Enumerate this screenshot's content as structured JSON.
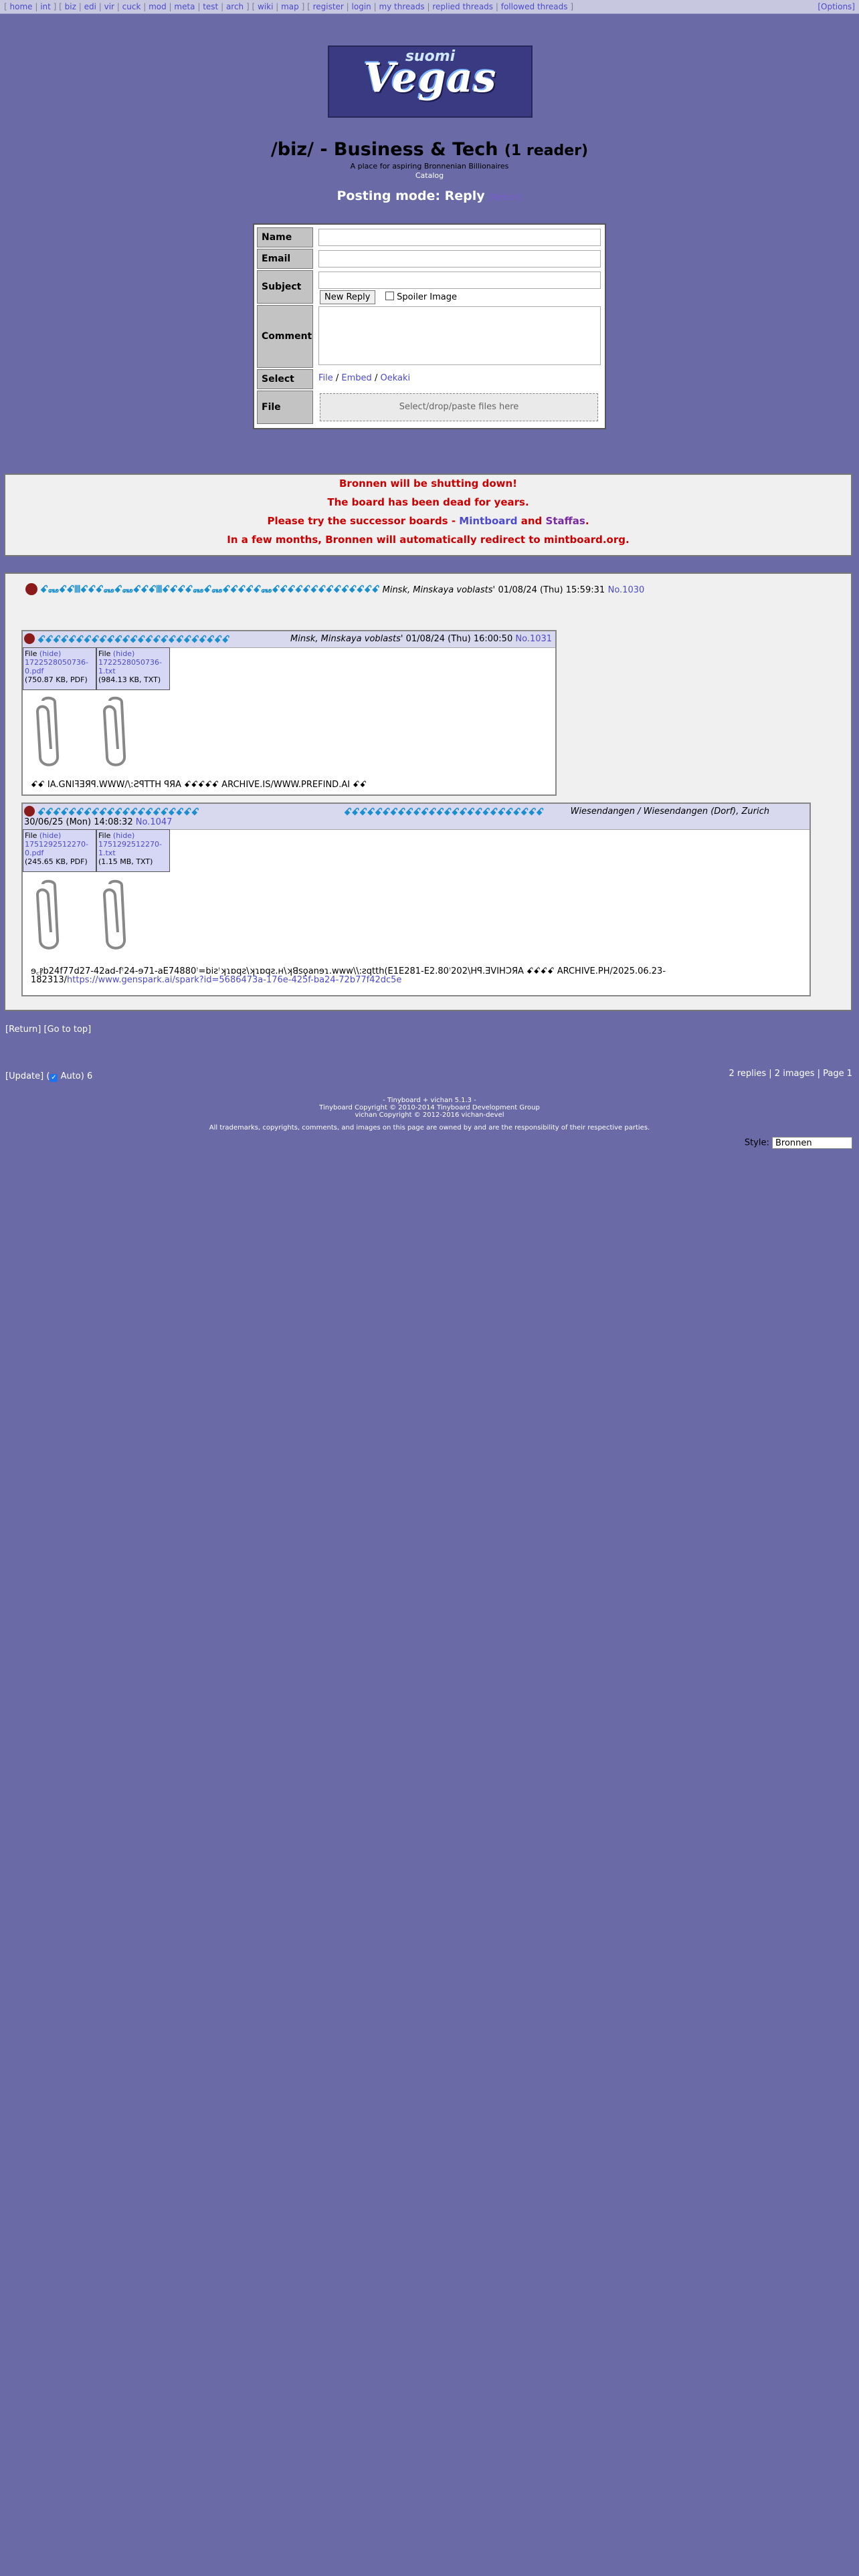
{
  "topnav": {
    "links": [
      "home",
      "int",
      "biz",
      "edi",
      "vir",
      "cuck",
      "mod",
      "meta",
      "test",
      "arch",
      "wiki",
      "map",
      "register",
      "login",
      "my threads",
      "replied threads",
      "followed threads"
    ],
    "options": "[Options]"
  },
  "banner": {
    "logo_top": "suomi",
    "logo_main": "Vegas"
  },
  "board": {
    "title": "/biz/ - Business & Tech",
    "readers": "(1 reader)",
    "subtitle": "A place for aspiring Bronnenian Billionaires",
    "catalog": "Catalog",
    "posting_mode": "Posting mode: Reply",
    "return_link": "[Return]"
  },
  "form": {
    "name_label": "Name",
    "email_label": "Email",
    "subject_label": "Subject",
    "comment_label": "Comment",
    "select_label": "Select",
    "file_label": "File",
    "new_reply": "New Reply",
    "spoiler": "Spoiler Image",
    "select_opts": [
      "File",
      "Embed",
      "Oekaki"
    ],
    "dropzone": "Select/drop/paste files here"
  },
  "notice": {
    "line1": "Bronnen will be shutting down!",
    "line2": "The board has been dead for years.",
    "line3_pre": "Please try the successor boards -",
    "mintboard": "Mintboard",
    "and": "and",
    "staffas": "Staffas",
    "line4": "In a few months, Bronnen will automatically redirect to mintboard.org."
  },
  "op": {
    "subject": "ꗃ꘏ꗃꗃꘈꗃꗃꗃ꘏ꗃ꘏ꗃꗃꗃꘈꗃꗃꗃꗃ꘏ꗃ꘏ꗃꗃꗃꗃꗃ꘏ꗃꗃꗃꗃꗃꗃꗃꗃꗃꗃꗃꗃꗃꗃ",
    "name": "Minsk, Minskaya voblasts'",
    "date": "01/08/24 (Thu) 15:59:31",
    "no": "No.1030"
  },
  "replies": [
    {
      "subject": "ꗃꗃꗃꗃꗃꗃꗃꗃꗃꗃꗃꗃꗃꗃꗃꗃꗃꗃꗃꗃꗃꗃꗃꗃꗃ",
      "name": "Minsk, Minskaya voblasts'",
      "date": "01/08/24 (Thu) 16:00:50",
      "no": "No.1031",
      "files": [
        {
          "head": "File",
          "hide": "(hide)",
          "name": "1722528050736-0.pdf",
          "size": "(750.87 KB,",
          "extra": "PDF)"
        },
        {
          "head": "File",
          "hide": "(hide)",
          "name": "1722528050736-1.txt",
          "size": "(984.13 KB,",
          "extra": "TXT)"
        }
      ],
      "body": "ꗃꗃ IA.GNIꟻƎЯꟼ.WWW/\\:ƧꟼTTH ꟼЯA ꗃꗃꗃꗃꗃ ARCHIVE.IS/WWW.PREFIND.AI ꗃꗃ"
    },
    {
      "subject": "ꗃꗃꗃꗃꗃꗃꗃꗃꗃꗃꗃꗃꗃꗃꗃꗃꗃꗃꗃꗃꗃ",
      "subject2": "ꗃꗃꗃꗃꗃꗃꗃꗃꗃꗃꗃꗃꗃꗃꗃꗃꗃꗃꗃꗃꗃꗃꗃꗃꗃꗃ",
      "name": "Wiesendangen / Wiesendangen (Dorf), Zurich",
      "date": "30/06/25 (Mon) 14:08:32",
      "no": "No.1047",
      "files": [
        {
          "head": "File",
          "hide": "(hide)",
          "name": "1751292512270-0.pdf",
          "size": "(245.65 KB,",
          "extra": "PDF)"
        },
        {
          "head": "File",
          "hide": "(hide)",
          "name": "1751292512270-1.txt",
          "size": "(1.15 MB,",
          "extra": "TXT)"
        }
      ],
      "body1": "ɘ꜀ⳁb24f77d27-42ad-fꜝ24-ɘ71-aE74880ꜝ=biƨꜝʞɿɒqƨ\\ʞɿɒqƨ.ʜ\\ʞꓭsǫanɘɿ.www\\\\:ƨqtth(E1E281-E2.80ꜝ202\\Hꟼ.ƎVIHƆЯA  ꗃꗃꗃꗃ   ARCHIVE.PH/2025.06.23-",
      "body2_pre": "182313/",
      "body2_link": "https://www.genspark.ai/spark?id=5686473a-176e-425f-ba24-72b77f42dc5e"
    }
  ],
  "footer": {
    "return": "[Return]",
    "top": "[Go to top]",
    "update": "[Update] (",
    "auto": "Auto)",
    "count": "6",
    "stats": "2 replies | 2 images | Page 1",
    "credit1": "- Tinyboard + vichan 5.1.3 -",
    "credit2": "Tinyboard Copyright © 2010-2014 Tinyboard Development Group",
    "credit3": "vichan Copyright © 2012-2016 vichan-devel",
    "credit4": "All trademarks, copyrights, comments, and images on this page are owned by and are the responsibility of their respective parties.",
    "style_label": "Style:",
    "style_value": "Bronnen"
  }
}
